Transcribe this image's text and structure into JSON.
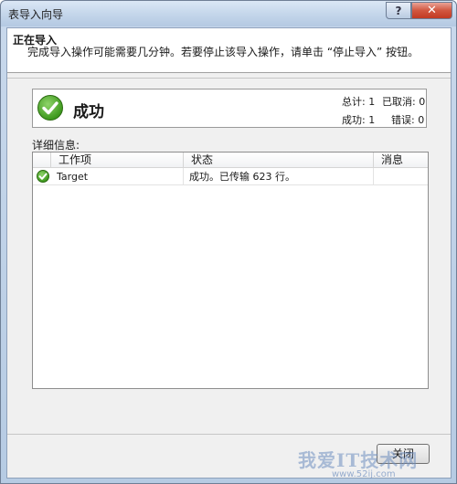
{
  "window": {
    "title": "表导入向导",
    "help_glyph": "?",
    "close_glyph": "✕"
  },
  "header": {
    "title": "正在导入",
    "description": "完成导入操作可能需要几分钟。若要停止该导入操作，请单击 “停止导入” 按钮。"
  },
  "status": {
    "text": "成功",
    "total_label": "总计: 1",
    "cancelled_label": "已取消: 0",
    "success_label": "成功: 1",
    "error_label": "错误: 0"
  },
  "details_label": "详细信息:",
  "grid": {
    "columns": [
      "工作项",
      "状态",
      "消息"
    ],
    "rows": [
      {
        "item": "Target",
        "status": "成功。已传输 623 行。",
        "message": ""
      }
    ]
  },
  "footer": {
    "close_label": "关闭"
  },
  "watermark": {
    "text": "我爱IT技术网",
    "url": "www.52ij.com"
  },
  "colors": {
    "success_green": "#3f9a1f",
    "title_bar": "#c3d5ea",
    "close_button": "#c23a22"
  }
}
